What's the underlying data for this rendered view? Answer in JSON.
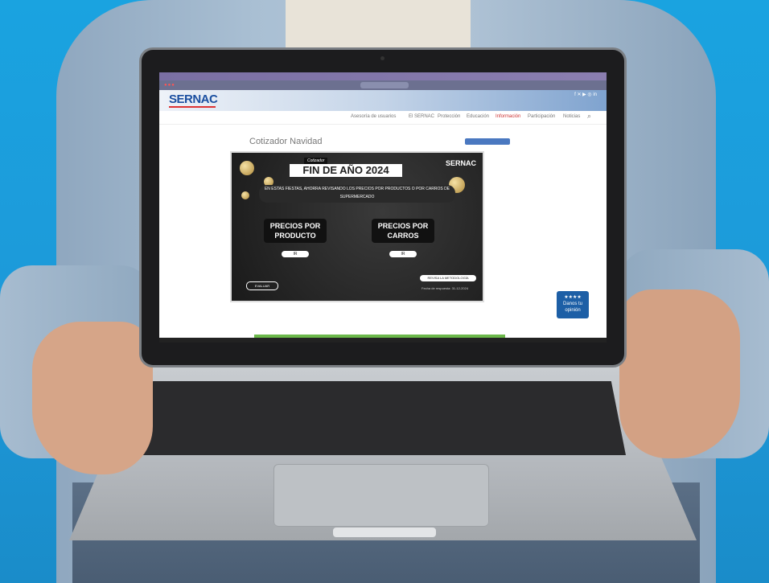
{
  "site": {
    "logo_text": "SERNAC",
    "page_title": "Cotizador Navidad",
    "nav": [
      "Asesoría de usuarios",
      "El SERNAC",
      "Protección",
      "Educación",
      "Información",
      "Participación",
      "Noticias"
    ]
  },
  "banner": {
    "subtitle": "Cotizador",
    "title": "FIN DE AÑO 2024",
    "logo": "SERNAC",
    "description": "EN ESTAS FIESTAS, AHORRA REVISANDO LOS PRECIOS POR PRODUCTOS O POR CARROS DE SUPERMERCADO",
    "card_product": "PRECIOS POR PRODUCTO",
    "card_carts": "PRECIOS POR CARROS",
    "go_label": "IR",
    "evaluate_label": "EVALUAR",
    "method_label": "REVISA LA METODOLOGÍA",
    "date_label": "Fecha de respuesta: 31-12-2024"
  },
  "feedback_badge": {
    "text": "Danos tu opinión"
  },
  "colors": {
    "background": "#1aa3e0",
    "sernac_blue": "#1b4fa0",
    "accent_green": "#6bb84a"
  }
}
